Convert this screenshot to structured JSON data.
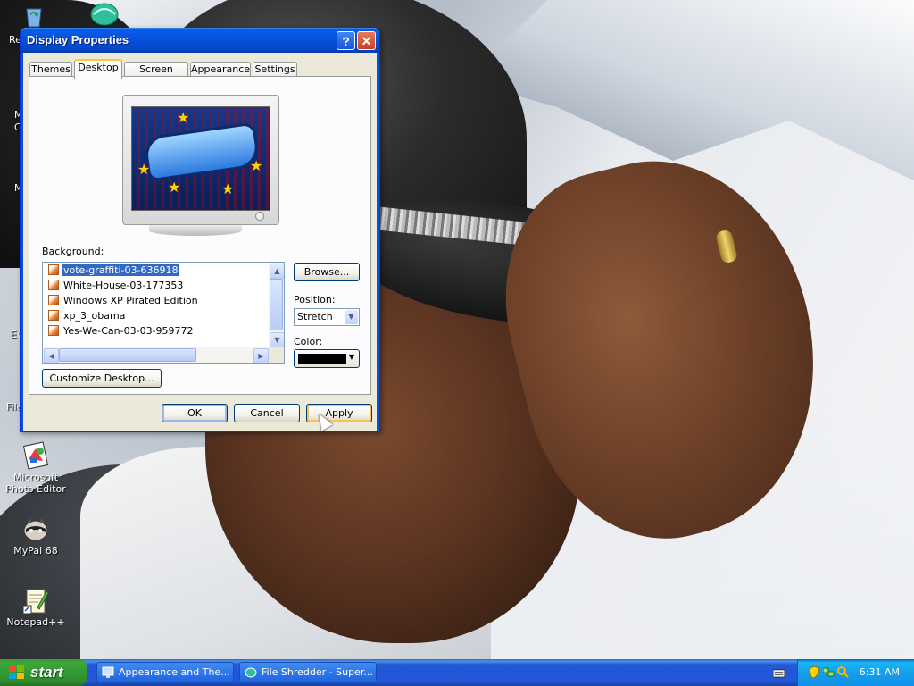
{
  "window": {
    "title": "Display Properties",
    "help_button": "?",
    "close_button": "✕"
  },
  "tabs": [
    {
      "label": "Themes",
      "active": false
    },
    {
      "label": "Desktop",
      "active": true
    },
    {
      "label": "Screen Saver",
      "active": false
    },
    {
      "label": "Appearance",
      "active": false
    },
    {
      "label": "Settings",
      "active": false
    }
  ],
  "desktop_tab": {
    "background_label": "Background:",
    "background_items": [
      {
        "name": "vote-graffiti-03-636918",
        "selected": true
      },
      {
        "name": "White-House-03-177353",
        "selected": false
      },
      {
        "name": "Windows XP Pirated Edition",
        "selected": false
      },
      {
        "name": "xp_3_obama",
        "selected": false
      },
      {
        "name": "Yes-We-Can-03-03-959772",
        "selected": false
      }
    ],
    "browse_button": "Browse...",
    "position_label": "Position:",
    "position_value": "Stretch",
    "color_label": "Color:",
    "color_value": "#000000",
    "customize_button": "Customize Desktop..."
  },
  "dialog_buttons": {
    "ok": "OK",
    "cancel": "Cancel",
    "apply": "Apply"
  },
  "desktop_icons": [
    {
      "label_line1": "Microsoft",
      "label_line2": "Photo Editor"
    },
    {
      "label_line1": "MyPal 68",
      "label_line2": ""
    },
    {
      "label_line1": "Notepad++",
      "label_line2": ""
    }
  ],
  "partial_icon_labels": [
    "Re",
    "M",
    "C",
    "M",
    "Ev",
    "File"
  ],
  "taskbar": {
    "start_label": "start",
    "tasks": [
      {
        "label": "Appearance and The..."
      },
      {
        "label": "File Shredder - Super..."
      }
    ],
    "clock": "6:31 AM"
  },
  "colors": {
    "titlebar": "#0553e0",
    "selection": "#316ac5",
    "taskbar": "#2456d8",
    "start": "#3ba83b",
    "tray": "#139beb"
  }
}
